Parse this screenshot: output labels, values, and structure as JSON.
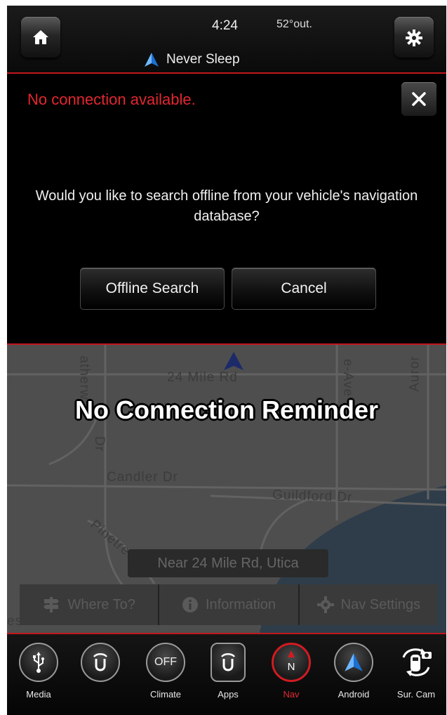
{
  "header": {
    "time": "4:24",
    "temperature": "52°out.",
    "app_title": "Never Sleep"
  },
  "dialog": {
    "error": "No connection available.",
    "question": "Would you like to search offline from your vehicle's navigation database?",
    "offline_label": "Offline Search",
    "cancel_label": "Cancel"
  },
  "map": {
    "caption": "No Connection Reminder",
    "streets": {
      "s1": "24 Mile Rd",
      "s2": "Candler Dr",
      "s3": "Guildford Dr",
      "s4": "Pinetree",
      "s5": "atherw",
      "s6": "Dr",
      "s7": "e-Ave",
      "s8": "Auror",
      "s9": "estmoor Dr"
    },
    "location": "Near 24 Mile Rd, Utica"
  },
  "nav_bar": {
    "where_to": "Where To?",
    "information": "Information",
    "nav_settings": "Nav Settings"
  },
  "dock": {
    "media": "Media",
    "uconnect": "",
    "climate": "Climate",
    "climate_icon_text": "OFF",
    "apps": "Apps",
    "nav": "Nav",
    "nav_icon_text": "N",
    "android": "Android",
    "surcam": "Sur. Cam"
  },
  "colors": {
    "accent_red": "#c2161c",
    "error_red": "#e3272f",
    "nav_blue": "#3a8fdc"
  }
}
